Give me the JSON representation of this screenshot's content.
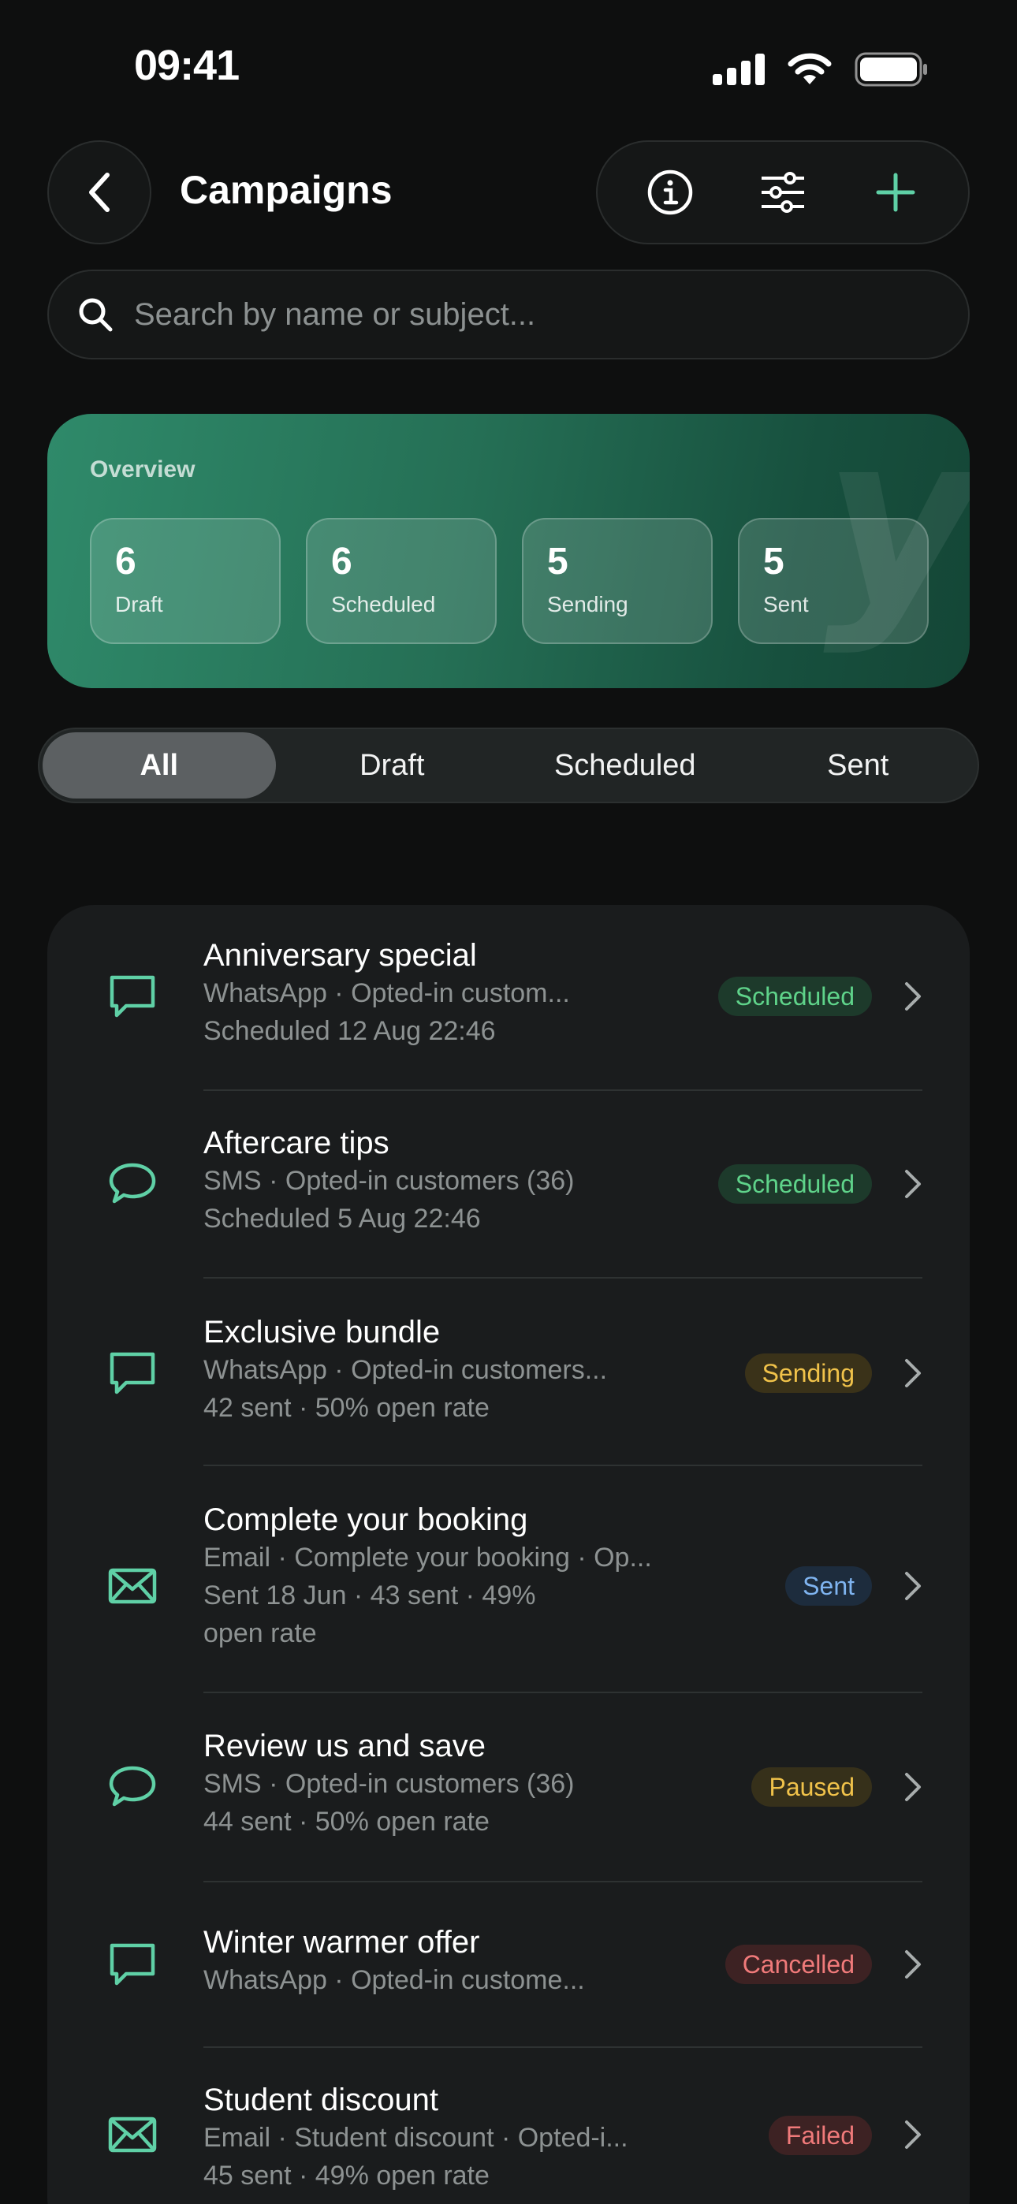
{
  "status_bar": {
    "time": "09:41"
  },
  "header": {
    "title": "Campaigns"
  },
  "search": {
    "placeholder": "Search by name or subject..."
  },
  "overview": {
    "label": "Overview",
    "stats": [
      {
        "value": "6",
        "label": "Draft"
      },
      {
        "value": "6",
        "label": "Scheduled"
      },
      {
        "value": "5",
        "label": "Sending"
      },
      {
        "value": "5",
        "label": "Sent"
      }
    ]
  },
  "tabs": [
    {
      "label": "All",
      "active": true
    },
    {
      "label": "Draft",
      "active": false
    },
    {
      "label": "Scheduled",
      "active": false
    },
    {
      "label": "Sent",
      "active": false
    }
  ],
  "campaigns": [
    {
      "title": "Anniversary special",
      "line1": "WhatsApp · Opted-in custom...",
      "line2": "Scheduled 12 Aug 22:46",
      "line3": "",
      "status": "Scheduled",
      "icon": "whatsapp-icon"
    },
    {
      "title": "Aftercare tips",
      "line1": "SMS · Opted-in customers (36)",
      "line2": "Scheduled 5 Aug 22:46",
      "line3": "",
      "status": "Scheduled",
      "icon": "sms-icon"
    },
    {
      "title": "Exclusive bundle",
      "line1": "WhatsApp · Opted-in customers...",
      "line2": "42 sent · 50% open rate",
      "line3": "",
      "status": "Sending",
      "icon": "whatsapp-icon"
    },
    {
      "title": "Complete your booking",
      "line1": "Email · Complete your booking · Op...",
      "line2": "Sent 18 Jun · 43 sent · 49%",
      "line3": "open rate",
      "status": "Sent",
      "icon": "email-icon"
    },
    {
      "title": "Review us and save",
      "line1": "SMS · Opted-in customers (36)",
      "line2": "44 sent · 50% open rate",
      "line3": "",
      "status": "Paused",
      "icon": "sms-icon"
    },
    {
      "title": "Winter warmer offer",
      "line1": "WhatsApp · Opted-in custome...",
      "line2": "",
      "line3": "",
      "status": "Cancelled",
      "icon": "whatsapp-icon"
    },
    {
      "title": "Student discount",
      "line1": "Email · Student discount · Opted-i...",
      "line2": "45 sent · 49% open rate",
      "line3": "",
      "status": "Failed",
      "icon": "email-icon"
    }
  ],
  "colors": {
    "accent": "#5fd0a6",
    "scheduled_text": "#5fd38a",
    "scheduled_bg": "#1d3a2b",
    "sending_text": "#f0c24a",
    "sending_bg": "#3a3219",
    "sent_text": "#7fb4f0",
    "sent_bg": "#1d2c3d",
    "paused_text": "#f0c24a",
    "paused_bg": "#36301a",
    "cancelled_text": "#f07a7a",
    "cancelled_bg": "#3d2223",
    "failed_text": "#f07a7a",
    "failed_bg": "#3d2223"
  }
}
